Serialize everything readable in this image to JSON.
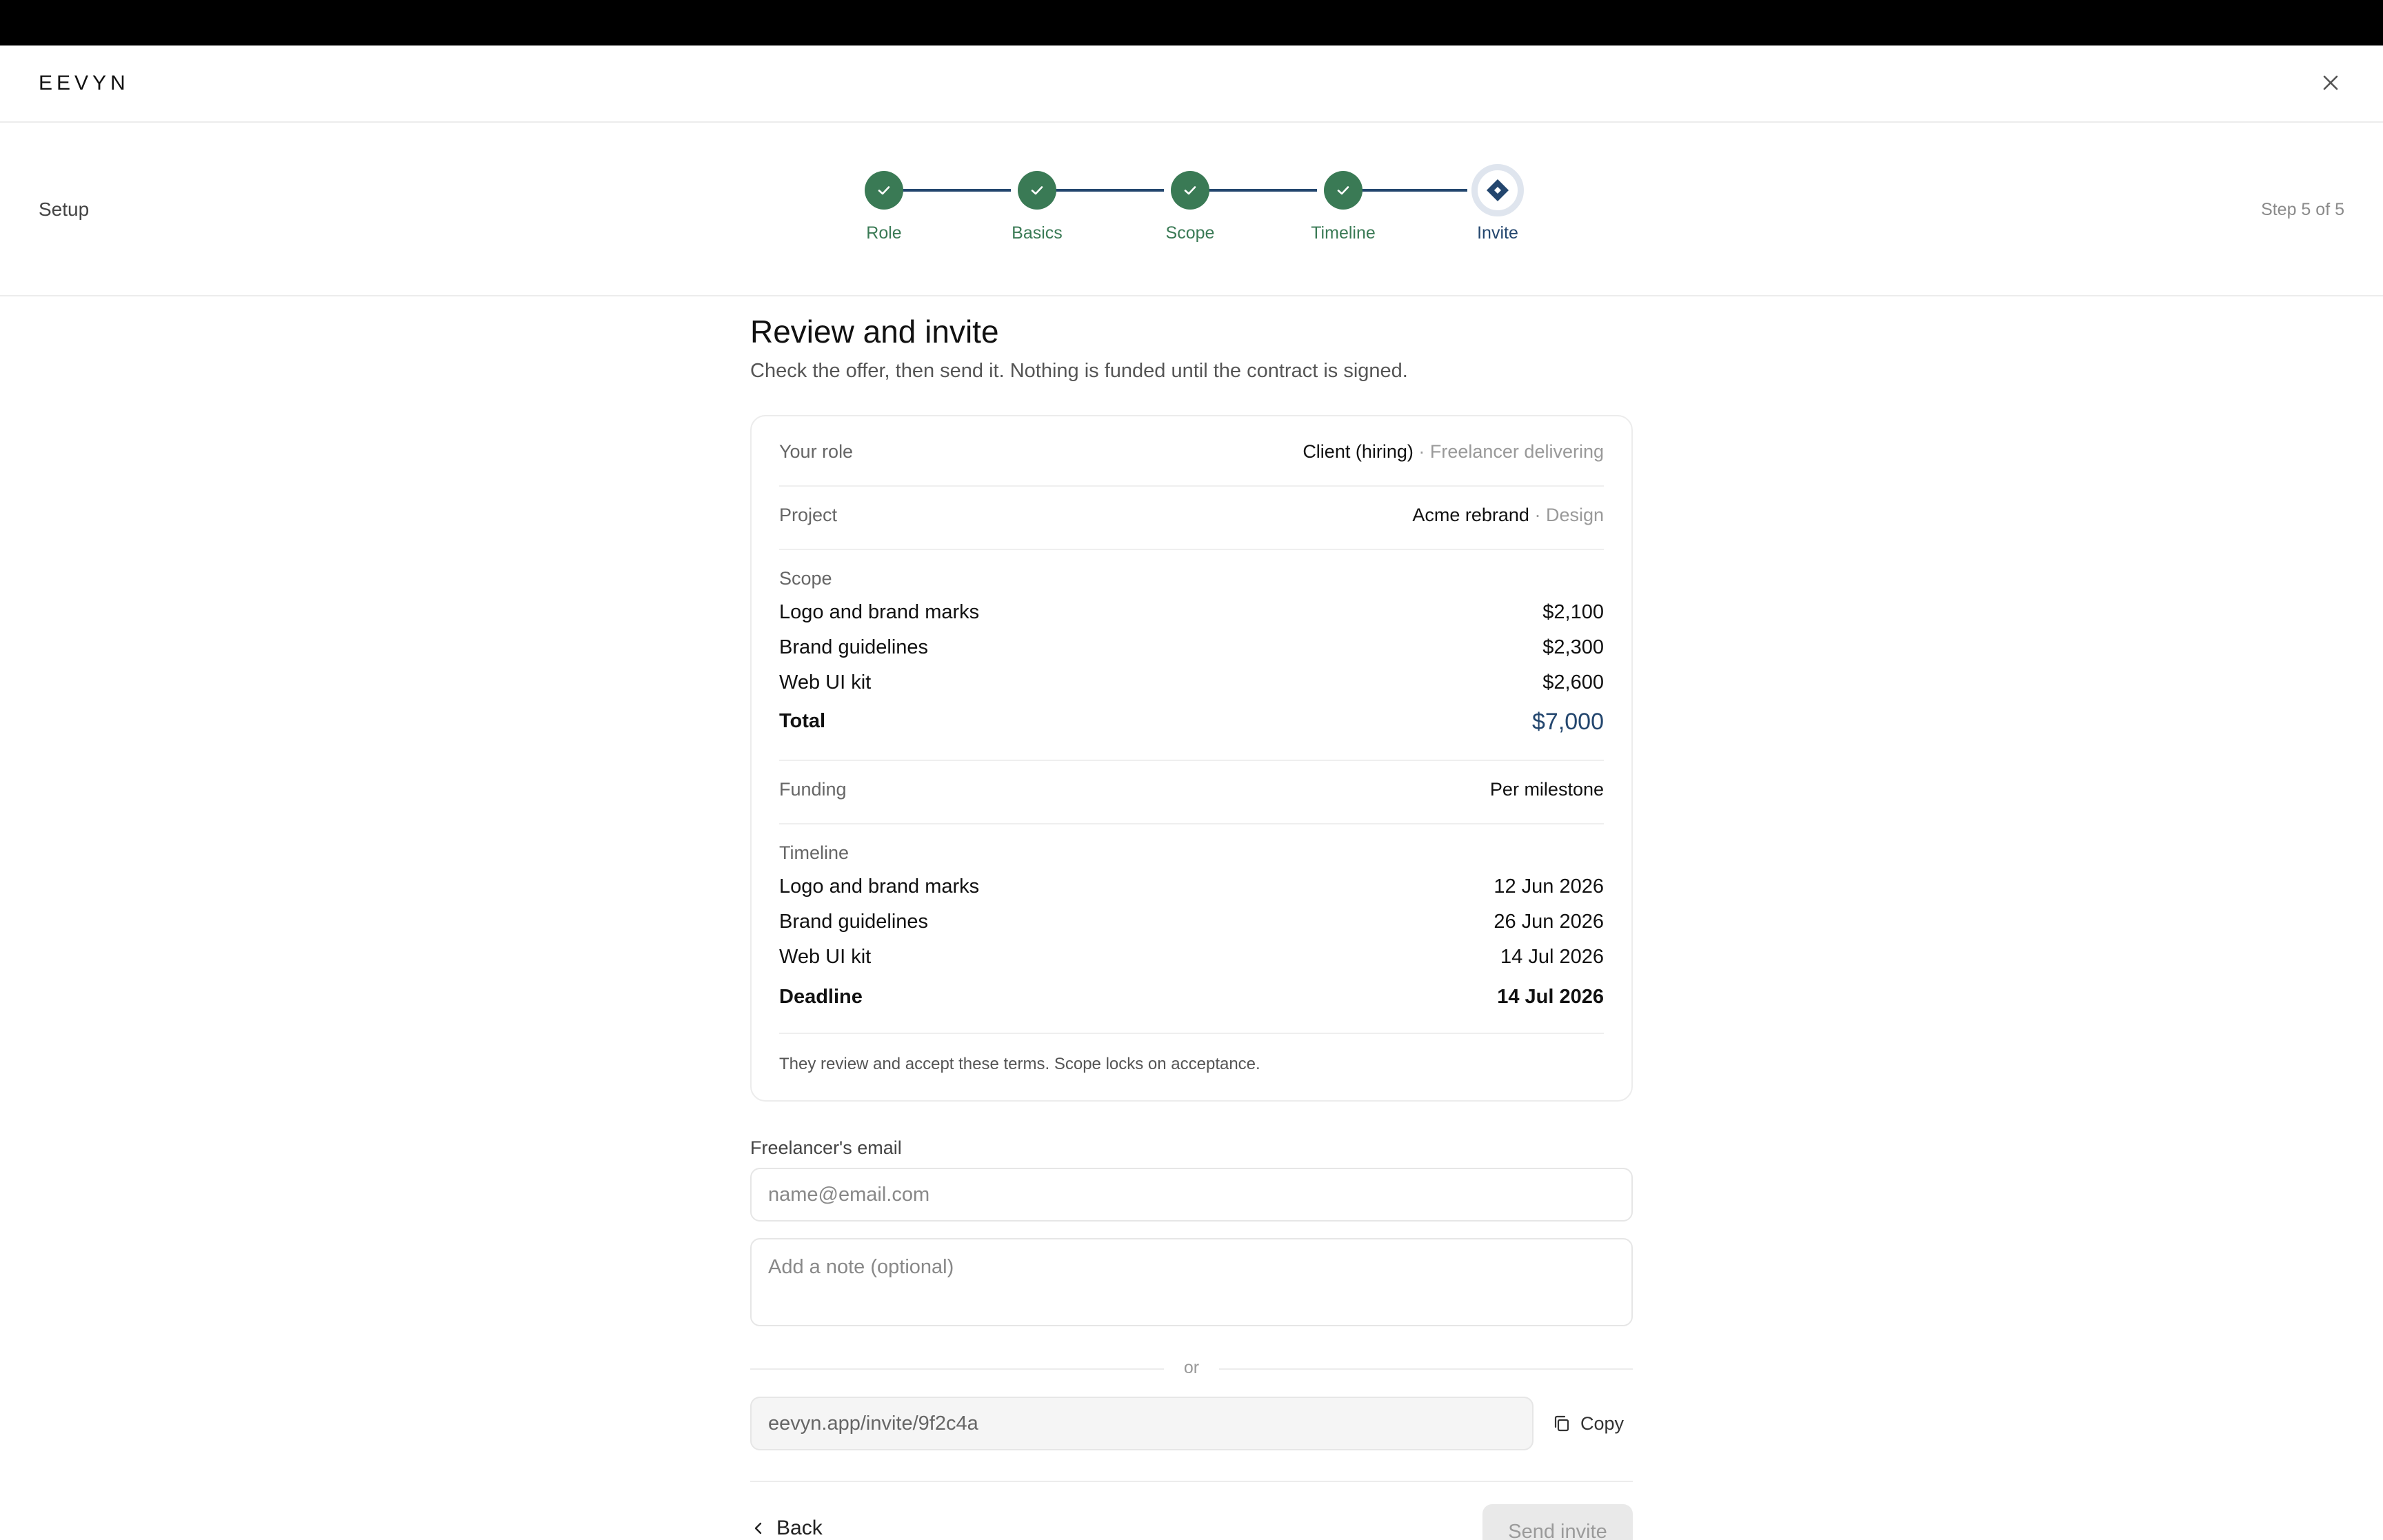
{
  "app": {
    "brand": "EEVYN",
    "close_icon": "close-icon"
  },
  "stepbar": {
    "section_label": "Setup",
    "step_count": "Step 5 of 5",
    "steps": [
      {
        "label": "Role",
        "state": "complete"
      },
      {
        "label": "Basics",
        "state": "complete"
      },
      {
        "label": "Scope",
        "state": "complete"
      },
      {
        "label": "Timeline",
        "state": "complete"
      },
      {
        "label": "Invite",
        "state": "current"
      }
    ]
  },
  "page": {
    "title": "Review and invite",
    "subtitle": "Check the offer, then send it. Nothing is funded until the contract is signed."
  },
  "summary": {
    "role": {
      "label": "Your role",
      "value": "Client (hiring)",
      "secondary": " · Freelancer delivering"
    },
    "project": {
      "label": "Project",
      "value": "Acme rebrand",
      "secondary": " · Design"
    },
    "scope": {
      "label": "Scope",
      "items": [
        {
          "name": "Logo and brand marks",
          "amount": "$2,100"
        },
        {
          "name": "Brand guidelines",
          "amount": "$2,300"
        },
        {
          "name": "Web UI kit",
          "amount": "$2,600"
        }
      ],
      "total_label": "Total",
      "total_amount": "$7,000"
    },
    "funding": {
      "label": "Funding",
      "value": "Per milestone"
    },
    "timeline": {
      "label": "Timeline",
      "items": [
        {
          "name": "Logo and brand marks",
          "date": "12 Jun 2026"
        },
        {
          "name": "Brand guidelines",
          "date": "26 Jun 2026"
        },
        {
          "name": "Web UI kit",
          "date": "14 Jul 2026"
        }
      ],
      "deadline_label": "Deadline",
      "deadline_date": "14 Jul 2026"
    },
    "note": "They review and accept these terms. Scope locks on acceptance."
  },
  "invite": {
    "email_label": "Freelancer's email",
    "email_placeholder": "name@email.com",
    "email_value": "",
    "note_placeholder": "Add a note (optional)",
    "or_text": "or",
    "invite_link": "eevyn.app/invite/9f2c4a",
    "copy_label": "Copy"
  },
  "footer": {
    "back_label": "Back",
    "send_label": "Send invite"
  },
  "colors": {
    "complete": "#3a7a55",
    "accent": "#23466e",
    "disabled_bg": "#e9e9e9"
  }
}
